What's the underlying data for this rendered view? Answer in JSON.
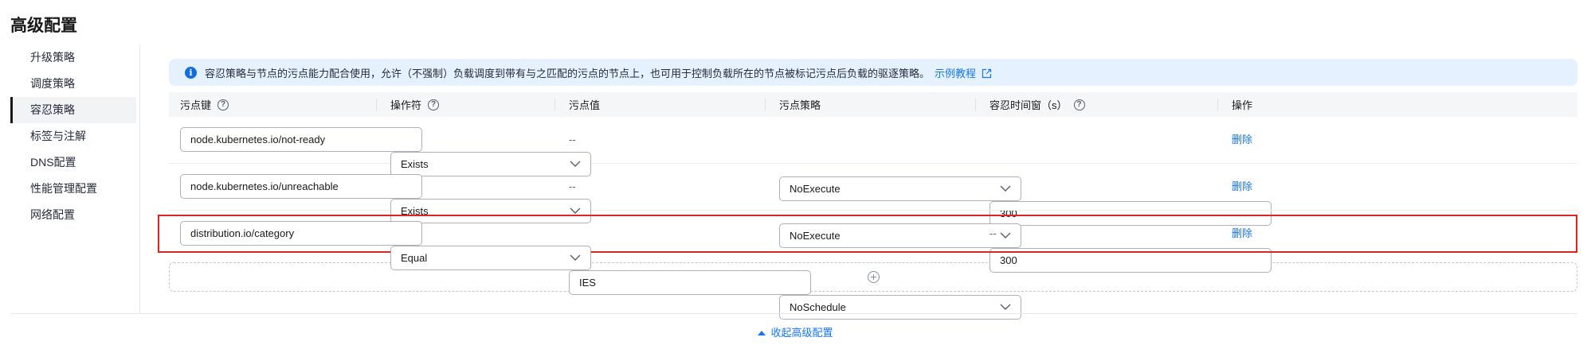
{
  "page_title": "高级配置",
  "sidebar": {
    "items": [
      {
        "label": "升级策略"
      },
      {
        "label": "调度策略"
      },
      {
        "label": "容忍策略",
        "active": true
      },
      {
        "label": "标签与注解"
      },
      {
        "label": "DNS配置"
      },
      {
        "label": "性能管理配置"
      },
      {
        "label": "网络配置"
      }
    ]
  },
  "info": {
    "icon": "info-icon",
    "text": "容忍策略与节点的污点能力配合使用，允许（不强制）负载调度到带有与之匹配的污点的节点上，也可用于控制负载所在的节点被标记污点后负载的驱逐策略。",
    "link_text": "示例教程",
    "link_icon": "external-link-icon"
  },
  "table": {
    "headers": {
      "key": "污点键",
      "operator": "操作符",
      "value": "污点值",
      "effect": "污点策略",
      "seconds": "容忍时间窗（s）",
      "action": "操作"
    },
    "rows": [
      {
        "key": "node.kubernetes.io/not-ready",
        "operator": "Exists",
        "value": "--",
        "effect": "NoExecute",
        "seconds": "300",
        "action": "删除"
      },
      {
        "key": "node.kubernetes.io/unreachable",
        "operator": "Exists",
        "value": "--",
        "effect": "NoExecute",
        "seconds": "300",
        "action": "删除"
      },
      {
        "key": "distribution.io/category",
        "operator": "Equal",
        "value": "IES",
        "effect": "NoSchedule",
        "seconds": "--",
        "action": "删除"
      }
    ]
  },
  "add_button_icon": "plus-circle-icon",
  "collapse_label": "收起高级配置",
  "colors": {
    "accent": "#1476ff",
    "highlight_border": "#e02424",
    "info_bg": "#e6f1ff"
  }
}
